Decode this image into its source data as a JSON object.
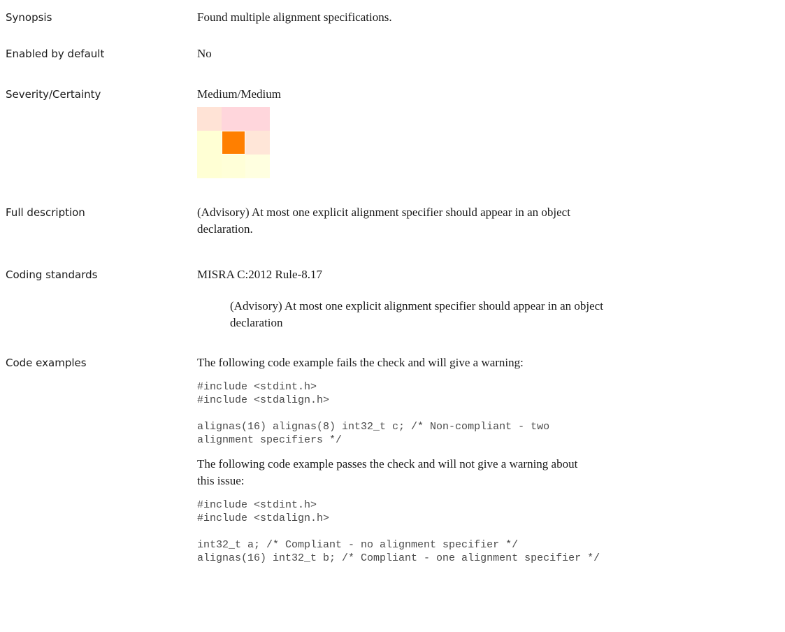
{
  "rows": {
    "synopsis": {
      "label": "Synopsis",
      "value": "Found multiple alignment specifications."
    },
    "enabled": {
      "label": "Enabled by default",
      "value": "No"
    },
    "severity": {
      "label": "Severity/Certainty",
      "value": "Medium/Medium",
      "matrix": {
        "severity": "Medium",
        "certainty": "Medium",
        "highlight_color": "#ff7f00"
      }
    },
    "full_description": {
      "label": "Full description",
      "value": " (Advisory) At most one explicit alignment specifier should appear in an object declaration."
    },
    "coding_standards": {
      "label": "Coding standards",
      "standard": "MISRA C:2012 Rule-8.17",
      "detail": "(Advisory) At most one explicit alignment specifier should appear in an object declaration"
    },
    "code_examples": {
      "label": "Code examples",
      "fail_intro": "The following code example fails the check and will give a warning:",
      "fail_code": "#include <stdint.h>\n#include <stdalign.h>\n\nalignas(16) alignas(8) int32_t c; /* Non-compliant - two\nalignment specifiers */",
      "pass_intro": "The following code example passes the check and will not give a warning about this issue:",
      "pass_code": "#include <stdint.h>\n#include <stdalign.h>\n\nint32_t a; /* Compliant - no alignment specifier */\nalignas(16) int32_t b; /* Compliant - one alignment specifier */"
    }
  }
}
